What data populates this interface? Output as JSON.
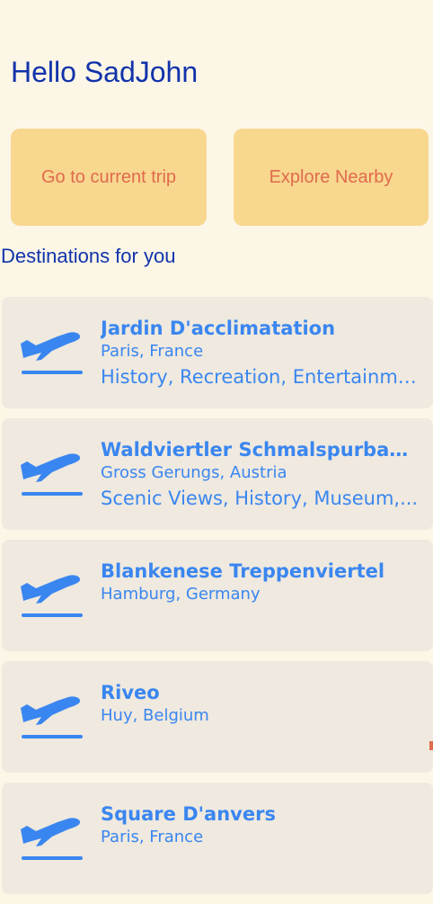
{
  "greeting": "Hello SadJohn",
  "actions": {
    "current_trip": "Go to current trip",
    "explore_nearby": "Explore Nearby"
  },
  "section_title": "Destinations for you",
  "destinations": [
    {
      "name": "Jardin D'acclimatation",
      "location": "Paris, France",
      "tags": "History, Recreation, Entertainment",
      "icon": "airplane-departure-icon"
    },
    {
      "name": "Waldviertler Schmalspurbahnv...",
      "location": "Gross Gerungs, Austria",
      "tags": "Scenic Views, History, Museum,...",
      "icon": "airplane-departure-icon"
    },
    {
      "name": "Blankenese Treppenviertel",
      "location": "Hamburg, Germany",
      "tags": "",
      "icon": "airplane-departure-icon"
    },
    {
      "name": "Riveo",
      "location": "Huy, Belgium",
      "tags": "",
      "icon": "airplane-departure-icon"
    },
    {
      "name": "Square D'anvers",
      "location": "Paris, France",
      "tags": "",
      "icon": "airplane-departure-icon"
    }
  ],
  "colors": {
    "background": "#fcf6e7",
    "heading": "#1133aa",
    "button_bg": "#f8d78f",
    "button_text": "#e06b4d",
    "card_bg": "#efe9df",
    "accent": "#3a86f0"
  }
}
